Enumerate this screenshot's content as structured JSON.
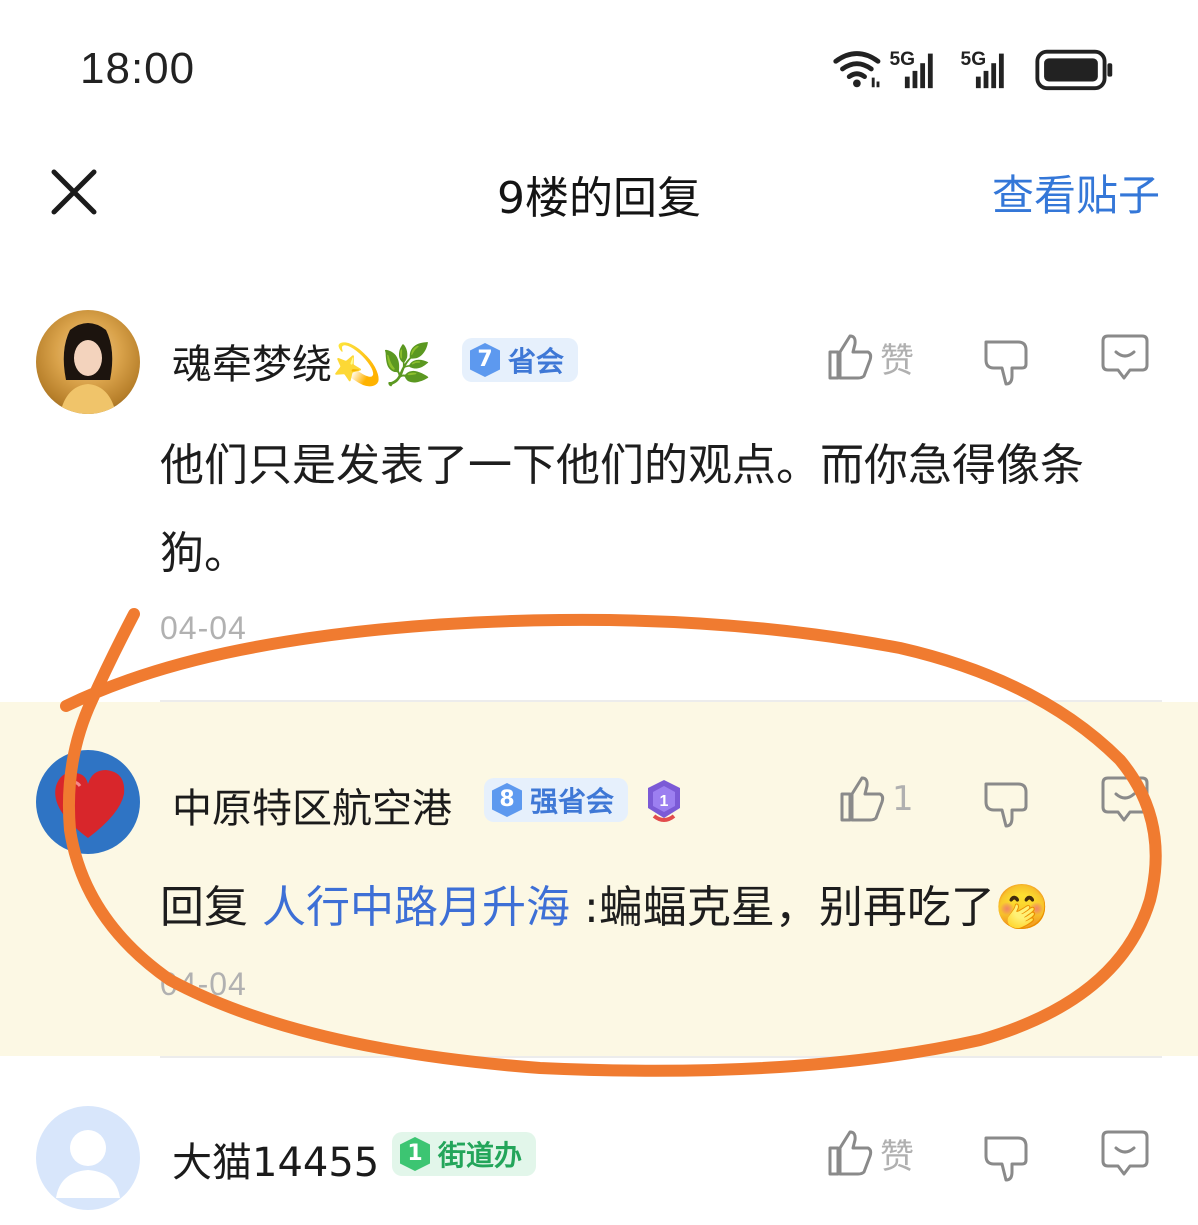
{
  "status_bar": {
    "time": "18:00",
    "network_1": "5G",
    "network_2": "5G"
  },
  "header": {
    "title": "9楼的回复",
    "view_post": "查看贴子"
  },
  "comments": [
    {
      "username": "魂牵梦绕",
      "name_emojis": "💫🌿",
      "level": "7",
      "level_title": "省会",
      "badge_color": "#5d99ef",
      "like_label": "赞",
      "text": "他们只是发表了一下他们的观点。而你急得像条狗。",
      "time": "04-04"
    },
    {
      "username": "中原特区航空港",
      "level": "8",
      "level_title": "强省会",
      "badge_color": "#5d99ef",
      "medal": "1",
      "like_count": "1",
      "reply_prefix": "回复",
      "reply_target": "人行中路月升海",
      "text": " :蝙蝠克星，别再吃了",
      "text_emoji": "🤭",
      "time": "04-04",
      "highlight_color": "#fcf8e4"
    },
    {
      "username": "大猫14455",
      "level": "1",
      "level_title": "街道办",
      "badge_color": "#3cc572",
      "like_label": "赞"
    }
  ],
  "annotation_color": "#f07b30",
  "link_color": "#3477d8",
  "icons": [
    "wifi-icon",
    "signal-icon",
    "battery-icon",
    "close-icon",
    "thumb-up-icon",
    "thumb-down-icon",
    "reply-bubble-icon",
    "medal-icon",
    "heart-icon",
    "default-avatar-icon"
  ]
}
